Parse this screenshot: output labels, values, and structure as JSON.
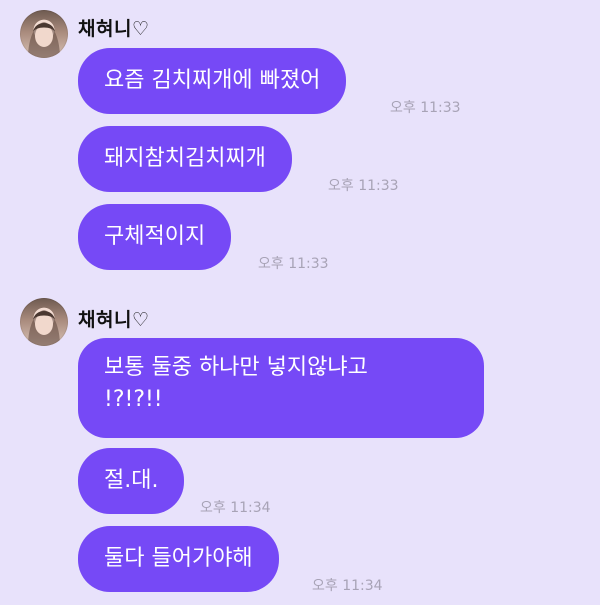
{
  "groups": [
    {
      "sender": "채혀니♡",
      "messages": [
        {
          "text": "요즘 김치찌개에 빠졌어",
          "time": "오후 11:33"
        },
        {
          "text": "돼지참치김치찌개",
          "time": "오후 11:33"
        },
        {
          "text": "구체적이지",
          "time": "오후 11:33"
        }
      ]
    },
    {
      "sender": "채혀니♡",
      "messages": [
        {
          "line1": "보통 둘중 하나만 넣지않냐고",
          "line2": "!?!?!!"
        },
        {
          "text": "절.대.",
          "time": "오후 11:34"
        },
        {
          "text": "둘다 들어가야해",
          "time": "오후 11:34"
        }
      ]
    }
  ],
  "colors": {
    "background": "#e8e2fb",
    "bubble": "#7649f6",
    "bubble_text": "#ffffff",
    "timestamp": "#a8a3b6"
  }
}
